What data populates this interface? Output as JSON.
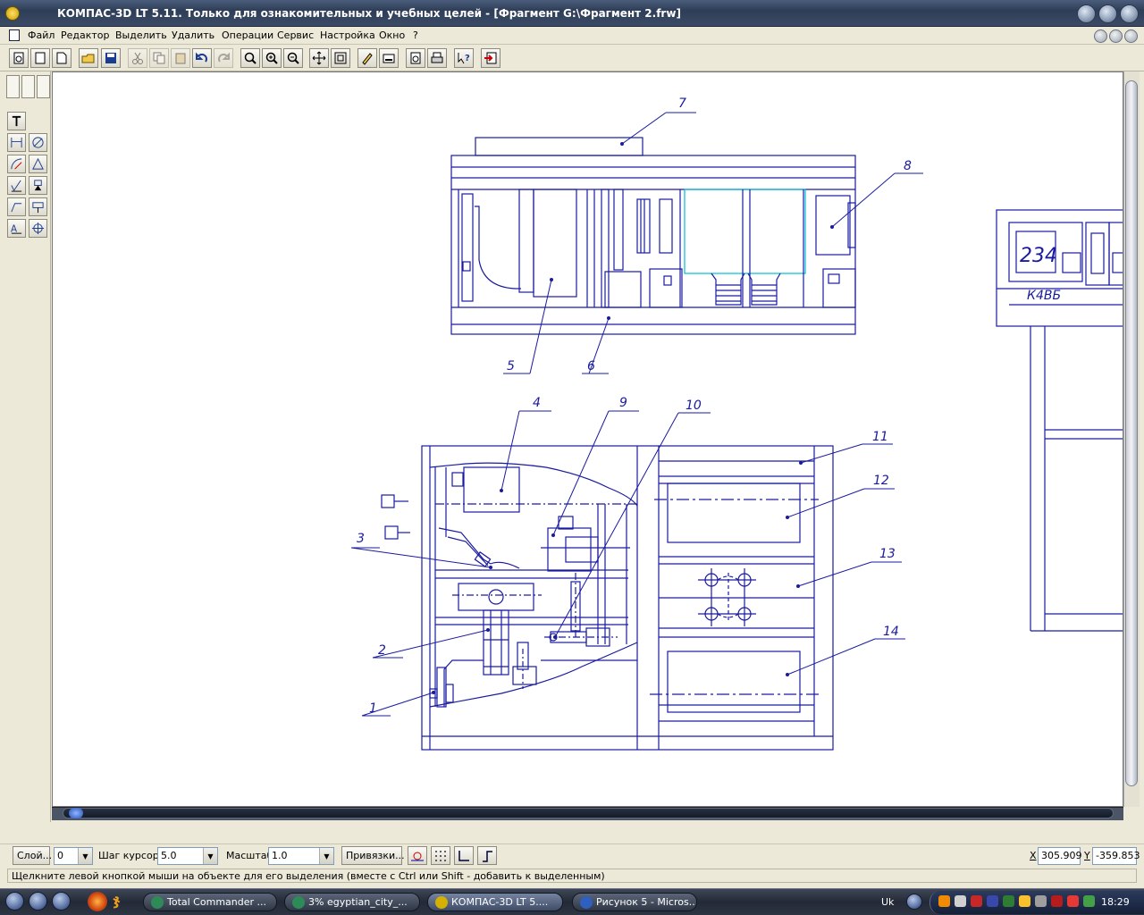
{
  "window": {
    "title": "КОМПАС-3D LT 5.11. Только для ознакомительных и учебных целей - [Фрагмент G:\\Фрагмент 2.frw]"
  },
  "menu": {
    "items": [
      "Файл",
      "Редактор",
      "Выделить",
      "Удалить",
      "Операции",
      "Сервис",
      "Настройка",
      "Окно",
      "?"
    ]
  },
  "toolbar": {
    "icons": [
      "new-document-icon",
      "new-sheet-icon",
      "new-fragment-icon",
      "open-icon",
      "save-icon",
      "cut-icon",
      "copy-icon",
      "paste-icon",
      "undo-icon",
      "redo-icon",
      "zoom-window-icon",
      "zoom-in-icon",
      "zoom-out-icon",
      "pan-icon",
      "zoom-all-icon",
      "properties-icon",
      "layer-icon",
      "print-preview-icon",
      "print-icon",
      "help-icon",
      "exit-icon"
    ]
  },
  "drawing": {
    "callouts": [
      "7",
      "8",
      "5",
      "6",
      "4",
      "9",
      "10",
      "11",
      "12",
      "3",
      "13",
      "2",
      "14",
      "1"
    ],
    "panel_display": "234",
    "panel_label": "К4ВБ"
  },
  "propbar": {
    "layer_button": "Слой...",
    "layer_value": "0",
    "step_label": "Шаг курсора",
    "step_value": "5.0",
    "scale_label": "Масштаб",
    "scale_value": "1.0",
    "snap_button": "Привязки...",
    "x_label": "X",
    "x_value": "305.909",
    "y_label": "Y",
    "y_value": "-359.853"
  },
  "status": {
    "hint": "Щелкните левой кнопкой мыши на объекте для его выделения (вместе с Ctrl или Shift - добавить к выделенным)"
  },
  "taskbar": {
    "tasks": [
      {
        "label": "Total Commander ...",
        "color": "#2e8b57"
      },
      {
        "label": "3% egyptian_city_...",
        "color": "#2e8b57"
      },
      {
        "label": "КОМПАС-3D LT 5....",
        "color": "#d4b000"
      },
      {
        "label": "Рисунок 5 - Micros...",
        "color": "#2f5fbf"
      }
    ],
    "language": "Uk",
    "clock": "18:29"
  },
  "colors": {
    "drawing_lines": "#1a1aa0",
    "drawing_accent": "#00bcd4"
  }
}
